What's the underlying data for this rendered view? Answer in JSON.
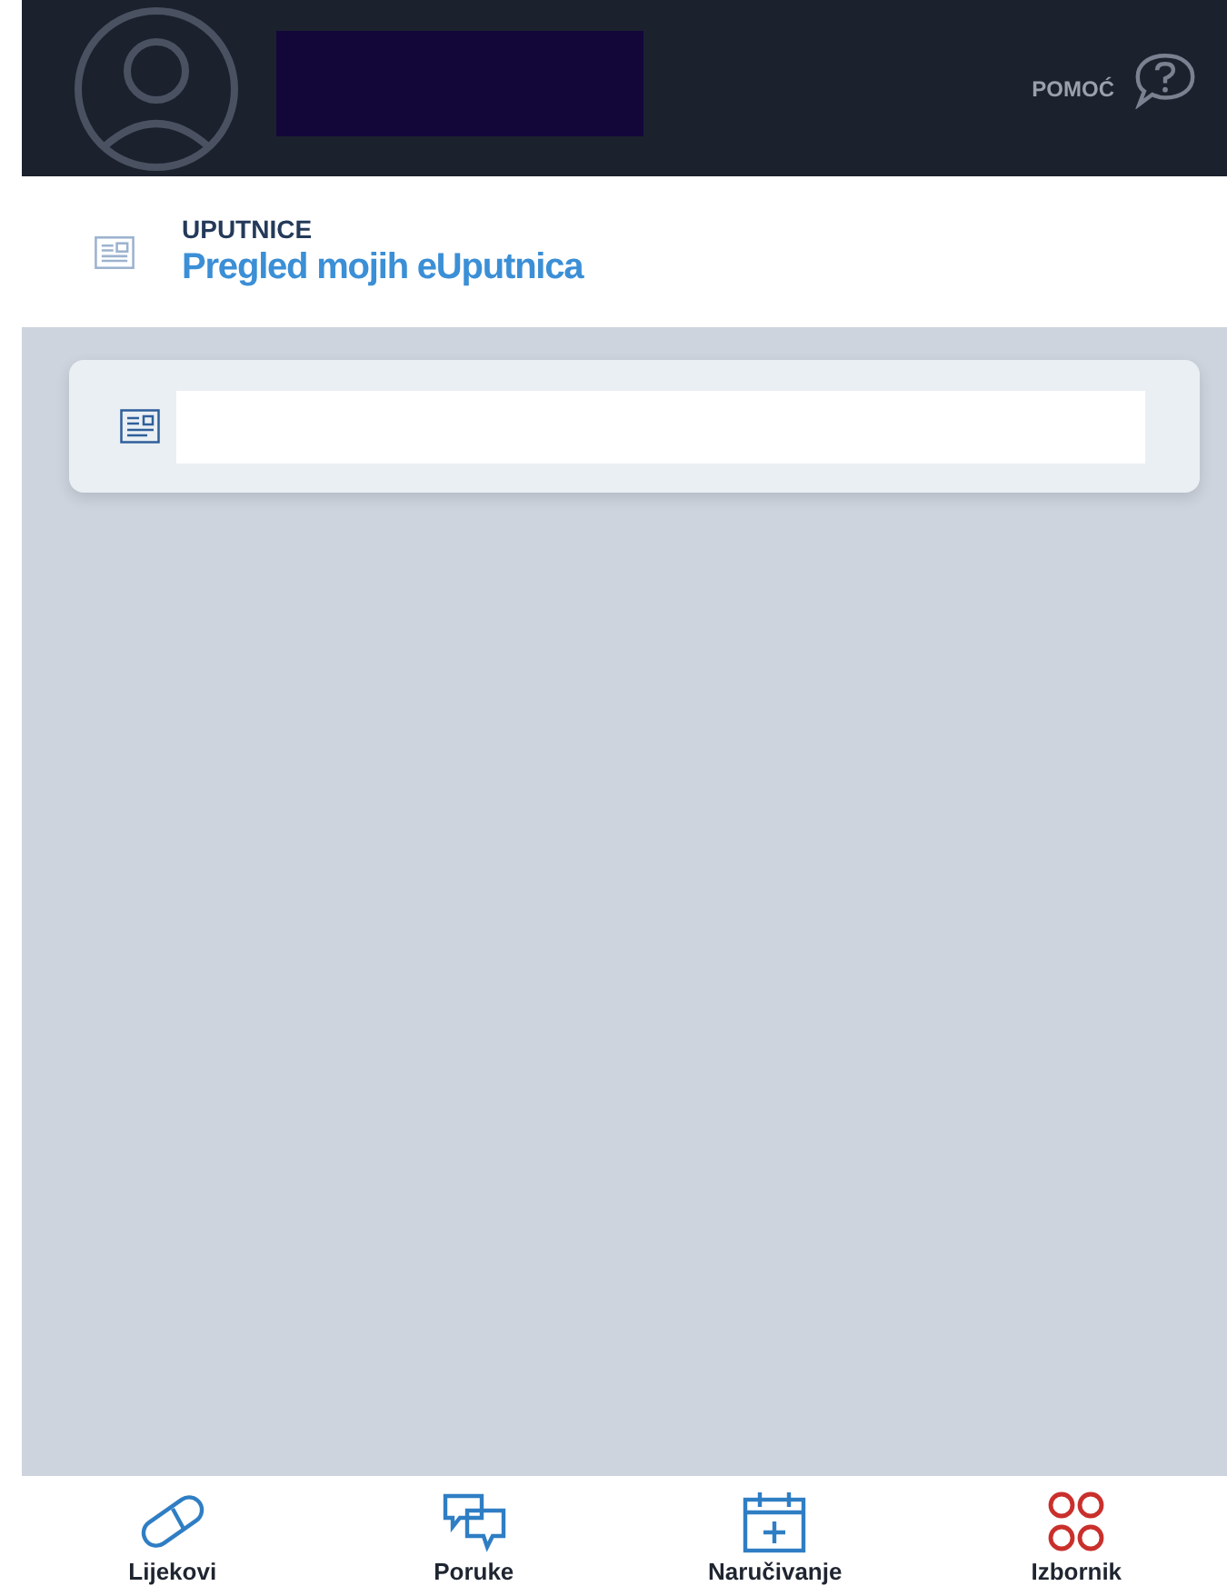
{
  "header": {
    "help_label": "POMOĆ"
  },
  "section": {
    "category": "UPUTNICE",
    "title": "Pregled mojih eUputnica"
  },
  "nav": [
    {
      "kind": "pill",
      "label": "Lijekovi",
      "selected": false
    },
    {
      "kind": "chat",
      "label": "Poruke",
      "selected": false
    },
    {
      "kind": "calendar",
      "label": "Naručivanje",
      "selected": false
    },
    {
      "kind": "grid",
      "label": "Izbornik",
      "selected": true
    }
  ]
}
